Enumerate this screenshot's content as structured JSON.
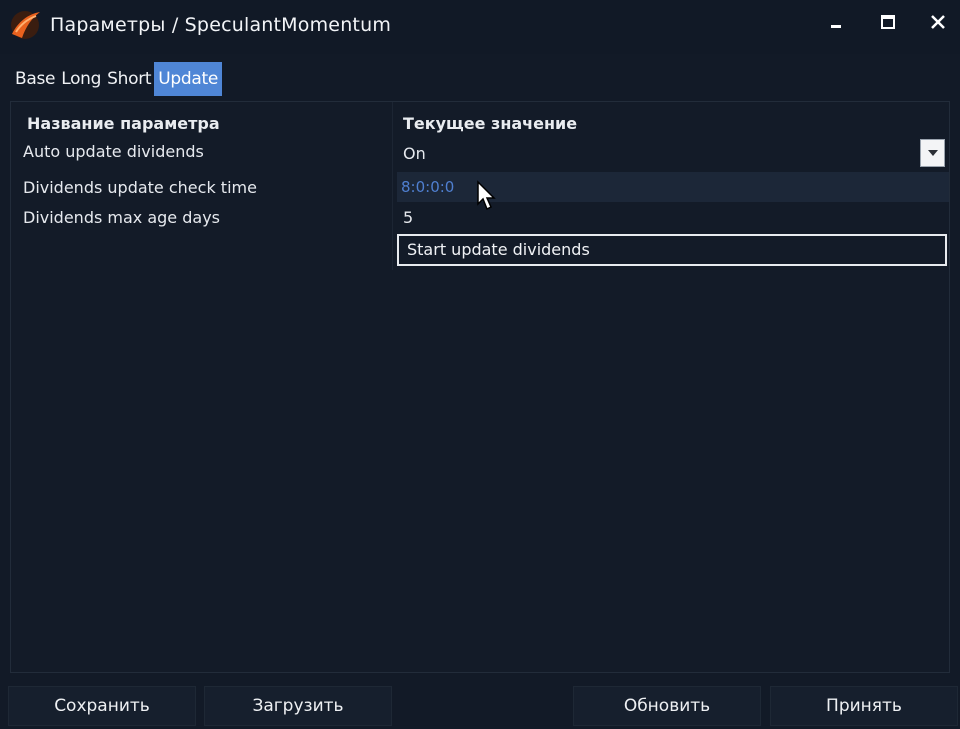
{
  "window": {
    "title": "Параметры / SpeculantMomentum",
    "icons": {
      "app": "app-logo-icon",
      "minimize": "minimize-icon",
      "maximize": "maximize-icon",
      "close": "close-icon"
    }
  },
  "tabs": [
    {
      "label": "Base",
      "active": false
    },
    {
      "label": "Long",
      "active": false
    },
    {
      "label": "Short",
      "active": false
    },
    {
      "label": "Update",
      "active": true
    }
  ],
  "grid": {
    "header_name": "Название параметра",
    "header_value": "Текущее значение",
    "rows": [
      {
        "name": "Auto update dividends",
        "value": "On",
        "control": "dropdown"
      },
      {
        "name": "Dividends update check time",
        "value": "8:0:0:0",
        "control": "text-editing"
      },
      {
        "name": "Dividends max age days",
        "value": "5",
        "control": "text"
      }
    ],
    "action_button": "Start update dividends"
  },
  "footer": {
    "save": "Сохранить",
    "load": "Загрузить",
    "refresh": "Обновить",
    "accept": "Принять"
  },
  "colors": {
    "background": "#121a27",
    "accent": "#4f86d6",
    "editing_text": "#4f7fd0"
  }
}
